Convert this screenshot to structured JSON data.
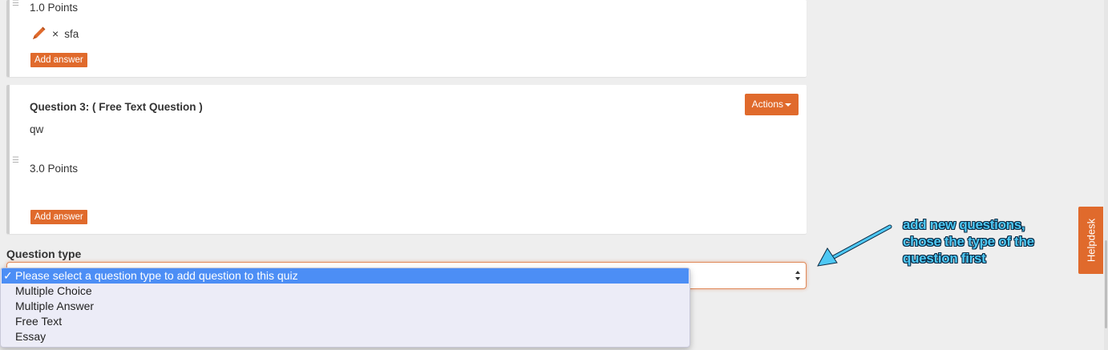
{
  "question2": {
    "points": "1.0 Points",
    "answers": [
      {
        "remove_symbol": "×",
        "text": "sfa"
      }
    ],
    "add_answer_label": "Add answer"
  },
  "question3": {
    "title": "Question 3: ( Free Text Question )",
    "body": "qw",
    "points": "3.0 Points",
    "actions_label": "Actions",
    "add_answer_label": "Add answer"
  },
  "question_type": {
    "label": "Question type",
    "options": [
      {
        "label": "Please select a question type to add question to this quiz",
        "selected": true
      },
      {
        "label": "Multiple Choice",
        "selected": false
      },
      {
        "label": "Multiple Answer",
        "selected": false
      },
      {
        "label": "Free Text",
        "selected": false
      },
      {
        "label": "Essay",
        "selected": false
      }
    ],
    "check_symbol": "✓"
  },
  "annotation": {
    "line1": "add  new questions,",
    "line2": "chose the type of the",
    "line3": "question first"
  },
  "helpdesk": {
    "label": "Helpdesk"
  },
  "icons": {
    "drag": "drag-handle-icon",
    "edit": "pencil-icon",
    "remove": "remove-icon",
    "dropdown": "caret-down-icon",
    "select": "select-arrows-icon",
    "check": "check-icon"
  },
  "colors": {
    "accent": "#e06a2c",
    "selected_option": "#4c8ef5",
    "annotation_text": "#4ec8f4",
    "annotation_outline": "#0b2a44",
    "page_background": "#eeeeee",
    "card_border": "#cfcfcf"
  }
}
